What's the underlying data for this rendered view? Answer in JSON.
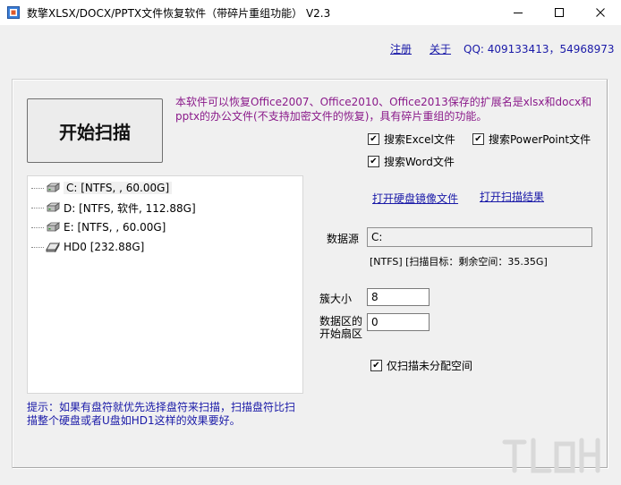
{
  "window": {
    "title": "数擎XLSX/DOCX/PPTX文件恢复软件（带碎片重组功能） V2.3",
    "minimize_icon": "minimize-icon",
    "maximize_icon": "maximize-icon",
    "close_icon": "close-icon"
  },
  "header": {
    "register_label": "注册",
    "about_label": "关于",
    "qq_text": "QQ: 409133413，54968973"
  },
  "scan_button_label": "开始扫描",
  "description": "本软件可以恢复Office2007、Office2010、Office2013保存的扩展名是xlsx和docx和pptx的办公文件(不支持加密文件的恢复)，具有碎片重组的功能。",
  "options": {
    "search_excel": {
      "label": "搜索Excel文件",
      "checked": true
    },
    "search_powerpoint": {
      "label": "搜索PowerPoint文件",
      "checked": true
    },
    "search_word": {
      "label": "搜索Word文件",
      "checked": true
    },
    "scan_unallocated": {
      "label": "仅扫描未分配空间",
      "checked": true
    }
  },
  "links": {
    "open_disk_image": "打开硬盘镜像文件",
    "open_scan_result": "打开扫描结果"
  },
  "drives": [
    {
      "text": "C:  [NTFS, , 60.00G]",
      "icon": "drive-icon",
      "selected": true
    },
    {
      "text": "D:  [NTFS, 软件, 112.88G]",
      "icon": "drive-icon",
      "selected": false
    },
    {
      "text": "E:  [NTFS, , 60.00G]",
      "icon": "drive-icon",
      "selected": false
    },
    {
      "text": "HD0   [232.88G]",
      "icon": "disk-icon",
      "selected": false
    }
  ],
  "source": {
    "label": "数据源",
    "value": "C:",
    "info": "[NTFS]  [扫描目标：剩余空间：35.35G]"
  },
  "cluster": {
    "label": "簇大小",
    "value": "8"
  },
  "start_sector": {
    "label_line1": "数据区的",
    "label_line2": "开始扇区",
    "value": "0"
  },
  "tip": "提示：如果有盘符就优先选择盘符来扫描，扫描盘符比扫描整个硬盘或者U盘如HD1这样的效果要好。",
  "colors": {
    "link": "#1a1aa8",
    "description": "#8a1a8a",
    "window_bg": "#f0f0f0"
  }
}
